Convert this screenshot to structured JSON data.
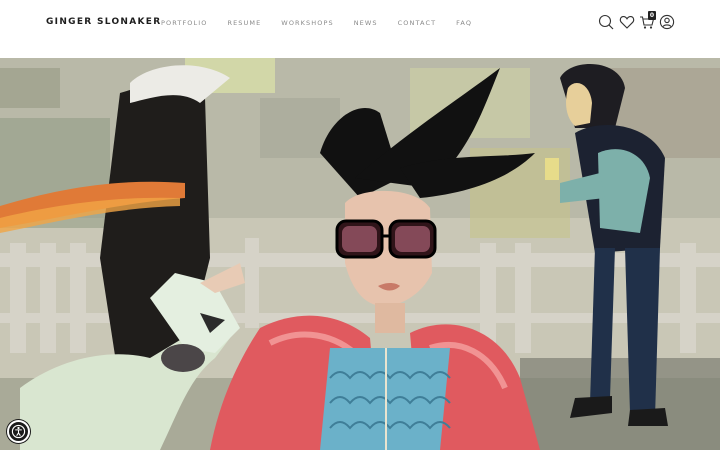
{
  "site": {
    "brand": "GINGER SLONAKER"
  },
  "nav": {
    "items": [
      {
        "label": "PORTFOLIO"
      },
      {
        "label": "RESUME"
      },
      {
        "label": "WORKSHOPS"
      },
      {
        "label": "NEWS"
      },
      {
        "label": "CONTACT"
      },
      {
        "label": "FAQ"
      }
    ]
  },
  "header_icons": {
    "search": "search-icon",
    "wishlist": "heart-icon",
    "cart": "cart-icon",
    "cart_count": "0",
    "account": "user-icon"
  },
  "hero": {
    "image": "painting of figures with a woman in red sunglasses and pink feather boa"
  },
  "accessibility": {
    "icon": "accessibility-icon"
  },
  "colors": {
    "text": "#1e1e1e",
    "nav_text": "#8a8a8a",
    "background": "#ffffff"
  }
}
